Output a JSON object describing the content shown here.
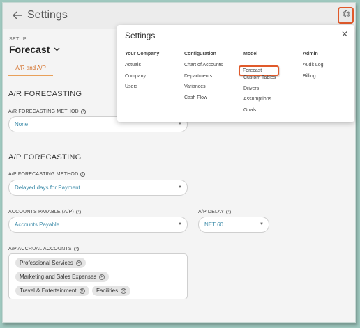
{
  "header": {
    "title": "Settings"
  },
  "page": {
    "setup_label": "SETUP",
    "title": "Forecast",
    "tab_label": "A/R and A/P"
  },
  "ar_section": {
    "heading": "A/R FORECASTING",
    "method_label": "A/R FORECASTING METHOD",
    "method_value": "None"
  },
  "ap_section": {
    "heading": "A/P FORECASTING",
    "method_label": "A/P FORECASTING METHOD",
    "method_value": "Delayed days for Payment",
    "payable_label": "ACCOUNTS PAYABLE (A/P)",
    "payable_value": "Accounts Payable",
    "delay_label": "A/P DELAY",
    "delay_value": "NET 60",
    "accrual_label": "A/P ACCRUAL ACCOUNTS",
    "accrual_chips": [
      "Professional Services",
      "Marketing and Sales Expenses",
      "Travel & Entertainment",
      "Facilities"
    ]
  },
  "settings_popup": {
    "title": "Settings",
    "columns": [
      {
        "heading": "Your Company",
        "items": [
          "Actuals",
          "Company",
          "Users"
        ]
      },
      {
        "heading": "Configuration",
        "items": [
          "Chart of Accounts",
          "Departments",
          "Variances",
          "Cash Flow"
        ]
      },
      {
        "heading": "Model",
        "items": [
          "Forecast",
          "Custom Tables",
          "Drivers",
          "Assumptions",
          "Goals"
        ]
      },
      {
        "heading": "Admin",
        "items": [
          "Audit Log",
          "Billing"
        ]
      }
    ],
    "highlighted_item": "Forecast"
  },
  "colors": {
    "accent_orange": "#e05a2b",
    "tab_orange": "#d2691e",
    "select_text": "#3a8aa8",
    "frame_bg": "#9fc8bf"
  }
}
